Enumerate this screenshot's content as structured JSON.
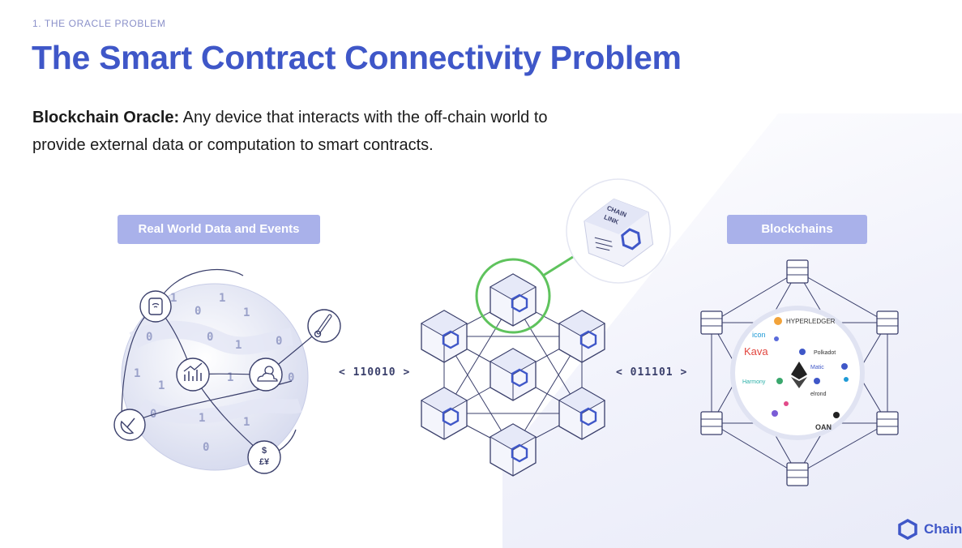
{
  "header": {
    "section_label": "1. THE ORACLE PROBLEM",
    "title": "The Smart Contract Connectivity Problem"
  },
  "definition": {
    "term": "Blockchain Oracle:",
    "text": " Any device that interacts with the off-chain world to provide external data or computation to smart contracts."
  },
  "left_panel": {
    "label": "Real World Data and Events",
    "globe_digits": [
      "1",
      "0",
      "1",
      "1",
      "0",
      "0",
      "1",
      "0",
      "1",
      "1",
      "1",
      "0",
      "0",
      "1",
      "1",
      "0"
    ],
    "icons": [
      "smartwatch-icon",
      "thermometer-icon",
      "chart-icon",
      "weather-icon",
      "satellite-dish-icon",
      "currency-icon"
    ]
  },
  "center_panel": {
    "bits_in": "110010",
    "bits_out": "011101",
    "node_cube_label_1": "CHAIN",
    "node_cube_label_2": "LINK",
    "highlight_color": "#5fc35d"
  },
  "right_panel": {
    "label": "Blockchains",
    "logos": {
      "hyperledger": "HYPERLEDGER",
      "icon": "icon",
      "kava": "Kava",
      "polkadot": "Polkadot",
      "matic": "Matic",
      "harmony": "Harmony",
      "elrond": "elrond",
      "oan": "OAN"
    }
  },
  "footer": {
    "brand": "Chainli"
  },
  "colors": {
    "accent": "#3f57c8",
    "pill": "#a9b1ea",
    "line": "#3a3f6b",
    "cube_face": "#eef0fb"
  }
}
